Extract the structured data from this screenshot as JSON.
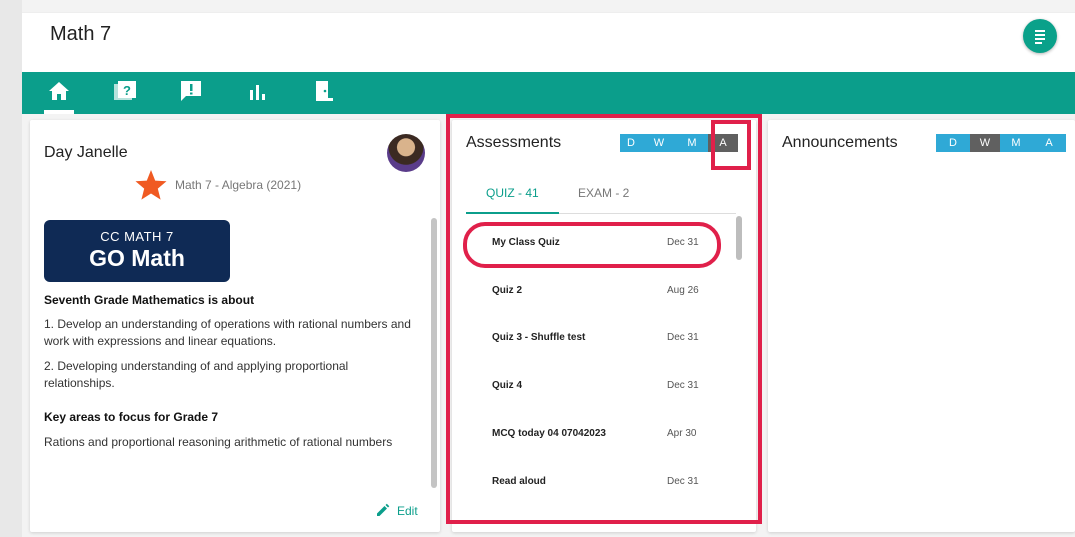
{
  "header": {
    "course_title": "Math 7",
    "menu_icon": "list-icon"
  },
  "nav": {
    "items": [
      {
        "icon": "home-icon"
      },
      {
        "icon": "quiz-book-icon"
      },
      {
        "icon": "announcement-icon"
      },
      {
        "icon": "bar-chart-icon"
      },
      {
        "icon": "exit-door-icon"
      }
    ]
  },
  "teacher": {
    "name": "Day Janelle",
    "course": "Math 7 - Algebra (2021)",
    "logo_line1": "CC MATH 7",
    "logo_line2": "GO Math",
    "heading1": "Seventh Grade Mathematics is about",
    "point1": "1. Develop an understanding of operations with rational numbers and work with expressions and linear equations.",
    "point2": "2. Developing understanding of and applying proportional relationships.",
    "heading2": "Key areas to focus for Grade 7",
    "point3": "Rations and proportional reasoning arithmetic of rational numbers",
    "edit_label": "Edit"
  },
  "assessments": {
    "title": "Assessments",
    "range": [
      "D",
      "W",
      "M",
      "A"
    ],
    "range_selected": "A",
    "tab_quiz": "QUIZ - 41",
    "tab_exam": "EXAM - 2",
    "quizzes": [
      {
        "name": "My Class Quiz",
        "date": "Dec 31"
      },
      {
        "name": "Quiz 2",
        "date": "Aug 26"
      },
      {
        "name": "Quiz 3 - Shuffle test",
        "date": "Dec 31"
      },
      {
        "name": "Quiz 4",
        "date": "Dec 31"
      },
      {
        "name": "MCQ today 04 07042023",
        "date": "Apr 30"
      },
      {
        "name": "Read aloud",
        "date": "Dec 31"
      }
    ]
  },
  "announcements": {
    "title": "Announcements",
    "range": [
      "D",
      "W",
      "M",
      "A"
    ],
    "range_selected": "W"
  },
  "colors": {
    "teal": "#0b9e8b",
    "segment_blue": "#2fa9d6",
    "segment_selected": "#606060",
    "highlight": "#e0204a",
    "logo_navy": "#0f2a55",
    "star": "#f05a22"
  }
}
